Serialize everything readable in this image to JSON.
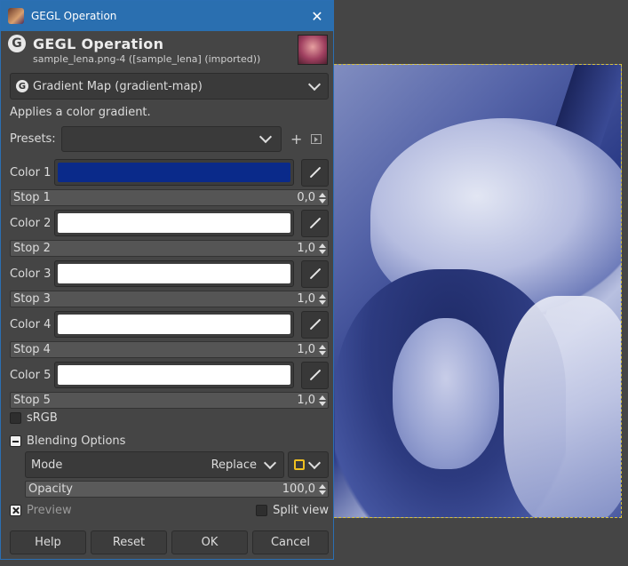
{
  "window": {
    "title": "GEGL Operation",
    "close_glyph": "✕"
  },
  "header": {
    "title": "GEGL Operation",
    "subtitle": "sample_lena.png-4 ([sample_lena] (imported))"
  },
  "operation": {
    "selected": "Gradient Map (gradient-map)",
    "description": "Applies a color gradient."
  },
  "presets": {
    "label": "Presets:",
    "value": "",
    "add_glyph": "+"
  },
  "colors": [
    {
      "label": "Color 1",
      "swatch": "#0a2a8a",
      "stop_label": "Stop 1",
      "stop_value": "0,0"
    },
    {
      "label": "Color 2",
      "swatch": "#ffffff",
      "stop_label": "Stop 2",
      "stop_value": "1,0"
    },
    {
      "label": "Color 3",
      "swatch": "#ffffff",
      "stop_label": "Stop 3",
      "stop_value": "1,0"
    },
    {
      "label": "Color 4",
      "swatch": "#ffffff",
      "stop_label": "Stop 4",
      "stop_value": "1,0"
    },
    {
      "label": "Color 5",
      "swatch": "#ffffff",
      "stop_label": "Stop 5",
      "stop_value": "1,0"
    }
  ],
  "srgb": {
    "label": "sRGB",
    "checked": false
  },
  "blending": {
    "label": "Blending Options",
    "mode_label": "Mode",
    "mode_value": "Replace",
    "opacity_label": "Opacity",
    "opacity_value": "100,0"
  },
  "preview": {
    "label": "Preview",
    "checked": true
  },
  "split_view": {
    "label": "Split view",
    "checked": false
  },
  "buttons": {
    "help": "Help",
    "reset": "Reset",
    "ok": "OK",
    "cancel": "Cancel"
  },
  "accent": "#2a6fb0"
}
